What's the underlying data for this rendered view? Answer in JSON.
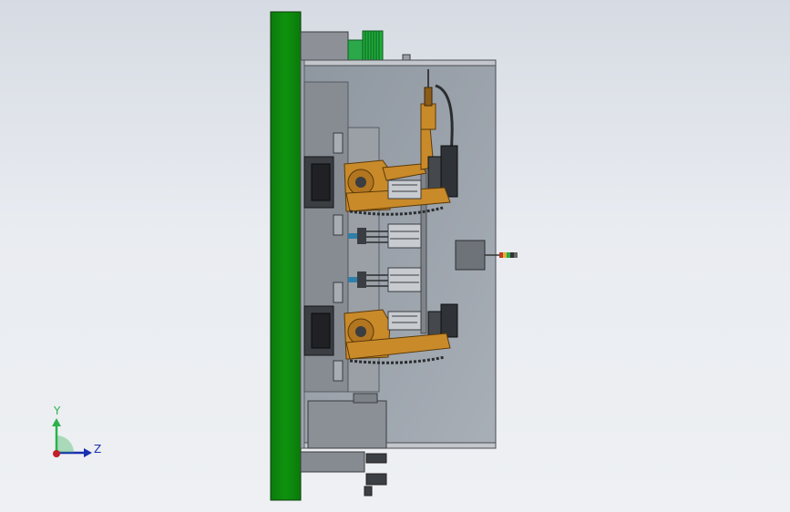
{
  "triad": {
    "y_label": "Y",
    "z_label": "Z",
    "colors": {
      "y": "#2bb24c",
      "z": "#1a2fb0",
      "x": "#c0202a"
    }
  },
  "colors": {
    "base_plate": "#0a8a0a",
    "robot": "#c98a2a",
    "frame": "#5a5f66",
    "glass": "#9aa2ab",
    "module": "#b7bcc2",
    "motor": "#1fae3c"
  },
  "icons": [
    "coordinate-triad-icon"
  ]
}
